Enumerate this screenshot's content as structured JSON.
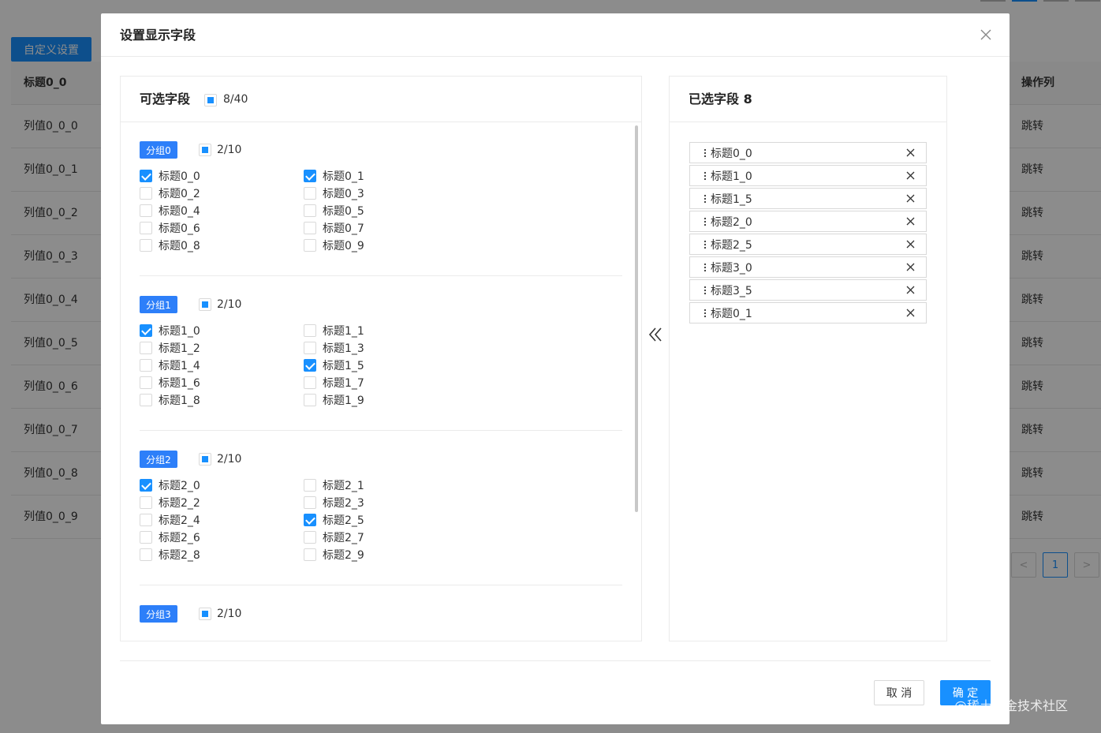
{
  "background": {
    "top_button": "自定义设置",
    "table_header": {
      "first_col": "标题0_0",
      "last_col": "操作列"
    },
    "rows": [
      {
        "value": "列值0_0_0",
        "action": "跳转"
      },
      {
        "value": "列值0_0_1",
        "action": "跳转"
      },
      {
        "value": "列值0_0_2",
        "action": "跳转"
      },
      {
        "value": "列值0_0_3",
        "action": "跳转"
      },
      {
        "value": "列值0_0_4",
        "action": "跳转"
      },
      {
        "value": "列值0_0_5",
        "action": "跳转"
      },
      {
        "value": "列值0_0_6",
        "action": "跳转"
      },
      {
        "value": "列值0_0_7",
        "action": "跳转"
      },
      {
        "value": "列值0_0_8",
        "action": "跳转"
      },
      {
        "value": "列值0_0_9",
        "action": "跳转"
      }
    ],
    "pagination": {
      "prev": "<",
      "current": "1",
      "next": ">"
    }
  },
  "modal": {
    "title": "设置显示字段",
    "left_panel": {
      "title": "可选字段",
      "count": "8/40",
      "groups": [
        {
          "tag": "分组0",
          "count": "2/10",
          "items": [
            {
              "label": "标题0_0",
              "checked": true
            },
            {
              "label": "标题0_1",
              "checked": true
            },
            {
              "label": "标题0_2",
              "checked": false
            },
            {
              "label": "标题0_3",
              "checked": false
            },
            {
              "label": "标题0_4",
              "checked": false
            },
            {
              "label": "标题0_5",
              "checked": false
            },
            {
              "label": "标题0_6",
              "checked": false
            },
            {
              "label": "标题0_7",
              "checked": false
            },
            {
              "label": "标题0_8",
              "checked": false
            },
            {
              "label": "标题0_9",
              "checked": false
            }
          ]
        },
        {
          "tag": "分组1",
          "count": "2/10",
          "items": [
            {
              "label": "标题1_0",
              "checked": true
            },
            {
              "label": "标题1_1",
              "checked": false
            },
            {
              "label": "标题1_2",
              "checked": false
            },
            {
              "label": "标题1_3",
              "checked": false
            },
            {
              "label": "标题1_4",
              "checked": false
            },
            {
              "label": "标题1_5",
              "checked": true
            },
            {
              "label": "标题1_6",
              "checked": false
            },
            {
              "label": "标题1_7",
              "checked": false
            },
            {
              "label": "标题1_8",
              "checked": false
            },
            {
              "label": "标题1_9",
              "checked": false
            }
          ]
        },
        {
          "tag": "分组2",
          "count": "2/10",
          "items": [
            {
              "label": "标题2_0",
              "checked": true
            },
            {
              "label": "标题2_1",
              "checked": false
            },
            {
              "label": "标题2_2",
              "checked": false
            },
            {
              "label": "标题2_3",
              "checked": false
            },
            {
              "label": "标题2_4",
              "checked": false
            },
            {
              "label": "标题2_5",
              "checked": true
            },
            {
              "label": "标题2_6",
              "checked": false
            },
            {
              "label": "标题2_7",
              "checked": false
            },
            {
              "label": "标题2_8",
              "checked": false
            },
            {
              "label": "标题2_9",
              "checked": false
            }
          ]
        },
        {
          "tag": "分组3",
          "count": "2/10",
          "items": []
        }
      ]
    },
    "right_panel": {
      "title": "已选字段 8",
      "selected": [
        "标题0_0",
        "标题1_0",
        "标题1_5",
        "标题2_0",
        "标题2_5",
        "标题3_0",
        "标题3_5",
        "标题0_1"
      ]
    },
    "footer": {
      "cancel": "取 消",
      "ok": "确 定"
    }
  },
  "watermark": "@稀土掘金技术社区",
  "colors": {
    "primary": "#1890ff",
    "tag": "#2d7ff9",
    "border": "#d9d9d9"
  }
}
